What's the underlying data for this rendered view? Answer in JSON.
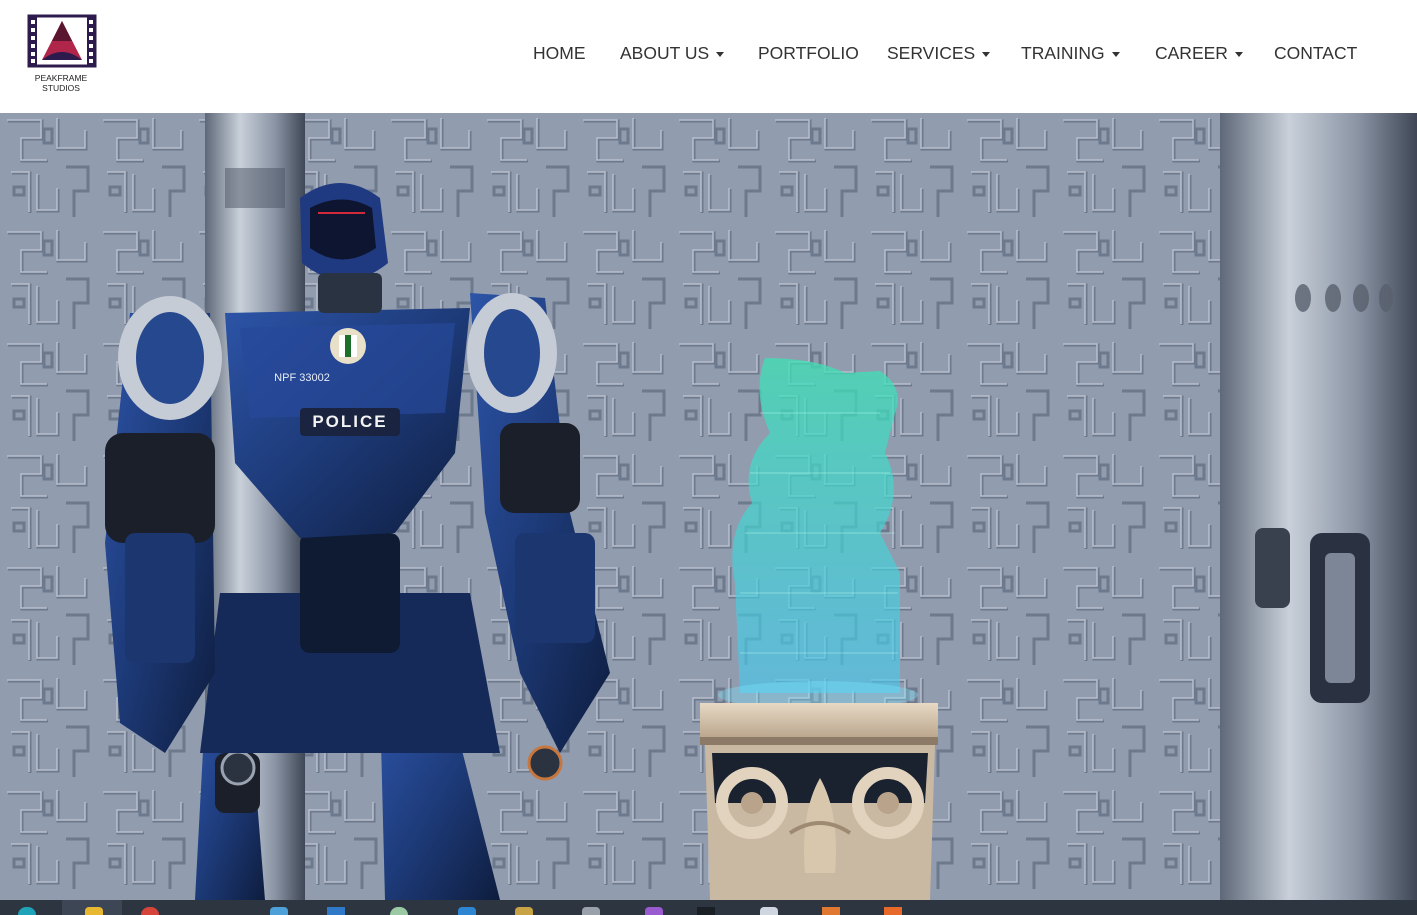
{
  "brand": {
    "logo_icon": "film-strip-triangle-logo",
    "line1": "PEAKFRAME",
    "line2": "STUDIOS",
    "logo_color": "#2d1b4e",
    "logo_accent": "#b0264a"
  },
  "nav": {
    "items": [
      {
        "label": "HOME",
        "dropdown": false
      },
      {
        "label": "ABOUT US",
        "dropdown": true
      },
      {
        "label": "PORTFOLIO",
        "dropdown": false
      },
      {
        "label": "SERVICES",
        "dropdown": true
      },
      {
        "label": "TRAINING",
        "dropdown": true
      },
      {
        "label": "CAREER",
        "dropdown": true
      },
      {
        "label": "CONTACT",
        "dropdown": false
      }
    ]
  },
  "hero": {
    "robot_badge": "NPF 33002",
    "robot_chest_label": "POLICE",
    "scene": "police-robot-beside-hologram-pedestal",
    "robot_color": "#1d3a78",
    "hologram_color": "#3fe0d2"
  },
  "taskbar": {
    "icons": [
      "start-icon",
      "file-explorer-icon",
      "chrome-icon",
      "app-icon",
      "browser-icon",
      "photoshop-icon",
      "app-icon",
      "app-icon",
      "app-icon",
      "app-icon",
      "app-icon",
      "app-icon",
      "app-icon",
      "app-icon",
      "app-icon"
    ]
  }
}
